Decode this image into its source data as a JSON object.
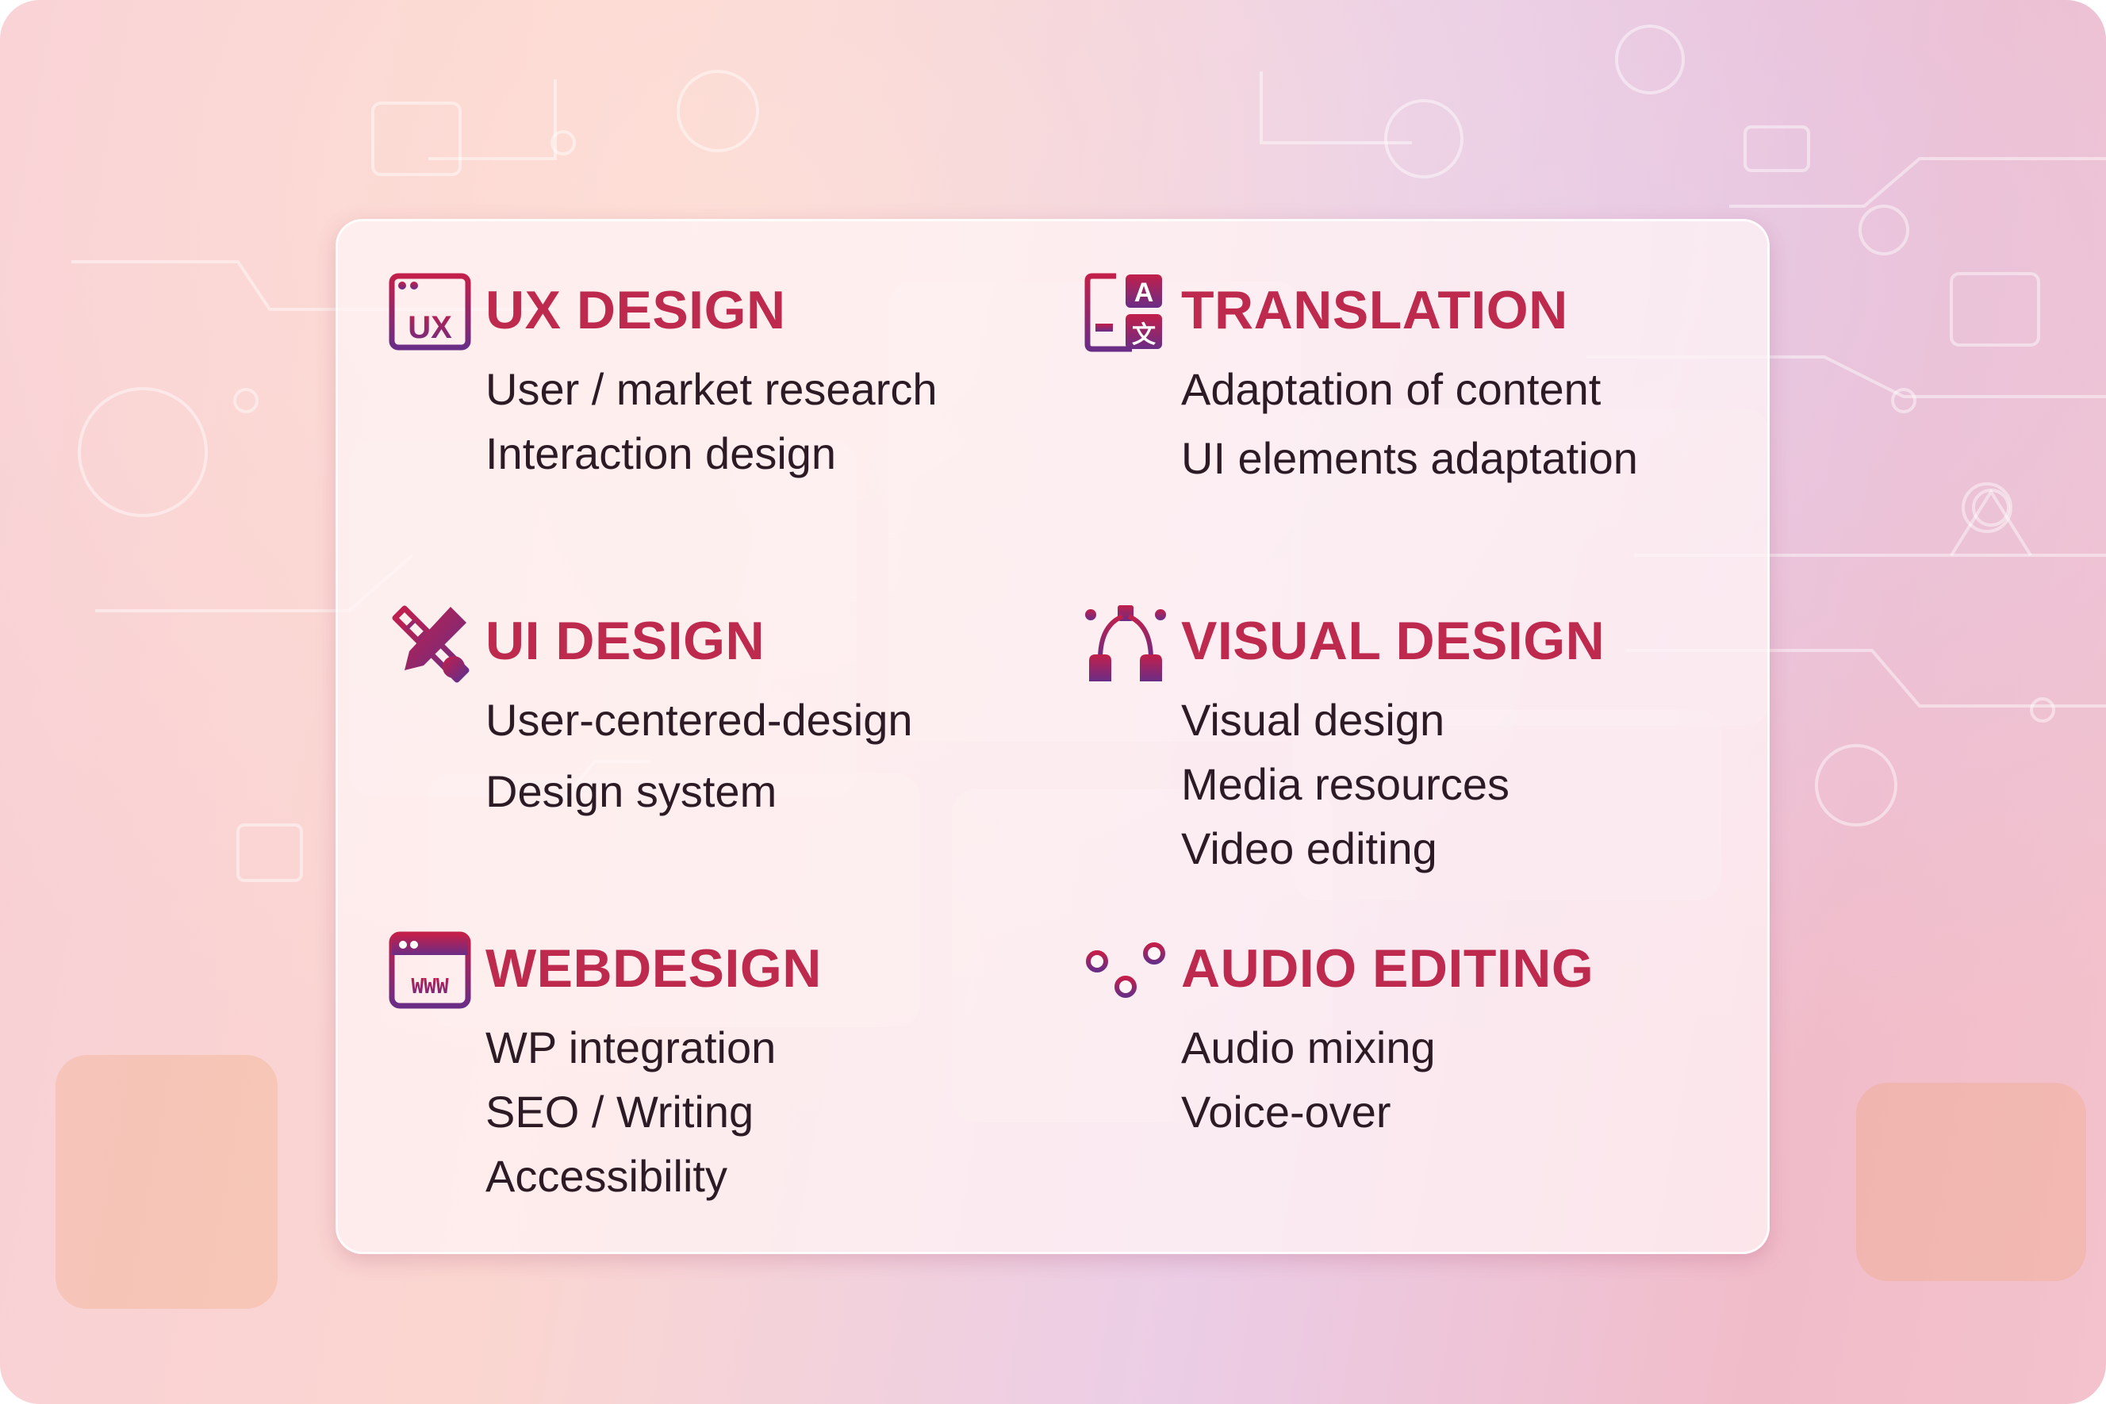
{
  "colors": {
    "accent": "#be2a4e",
    "icon_gradient": [
      "#c21f4a",
      "#6a2d86"
    ],
    "text": "#2c1a24"
  },
  "sections": [
    {
      "icon": "ux-window-icon",
      "title": "UX DESIGN",
      "items": [
        "User / market research",
        "Interaction design"
      ]
    },
    {
      "icon": "translate-icon",
      "title": "TRANSLATION",
      "items": [
        "Adaptation of content",
        "UI elements adaptation"
      ]
    },
    {
      "icon": "pencil-ruler-icon",
      "title": "UI DESIGN",
      "items": [
        "User-centered-design",
        "Design system"
      ]
    },
    {
      "icon": "bezier-pen-icon",
      "title": "VISUAL DESIGN",
      "items": [
        "Visual design",
        "Media resources",
        "Video editing"
      ]
    },
    {
      "icon": "www-window-icon",
      "title": "WEBDESIGN",
      "items": [
        "WP integration",
        "SEO / Writing",
        "Accessibility"
      ]
    },
    {
      "icon": "equalizer-icon",
      "title": "AUDIO EDITING",
      "items": [
        "Audio mixing",
        "Voice-over"
      ]
    }
  ]
}
